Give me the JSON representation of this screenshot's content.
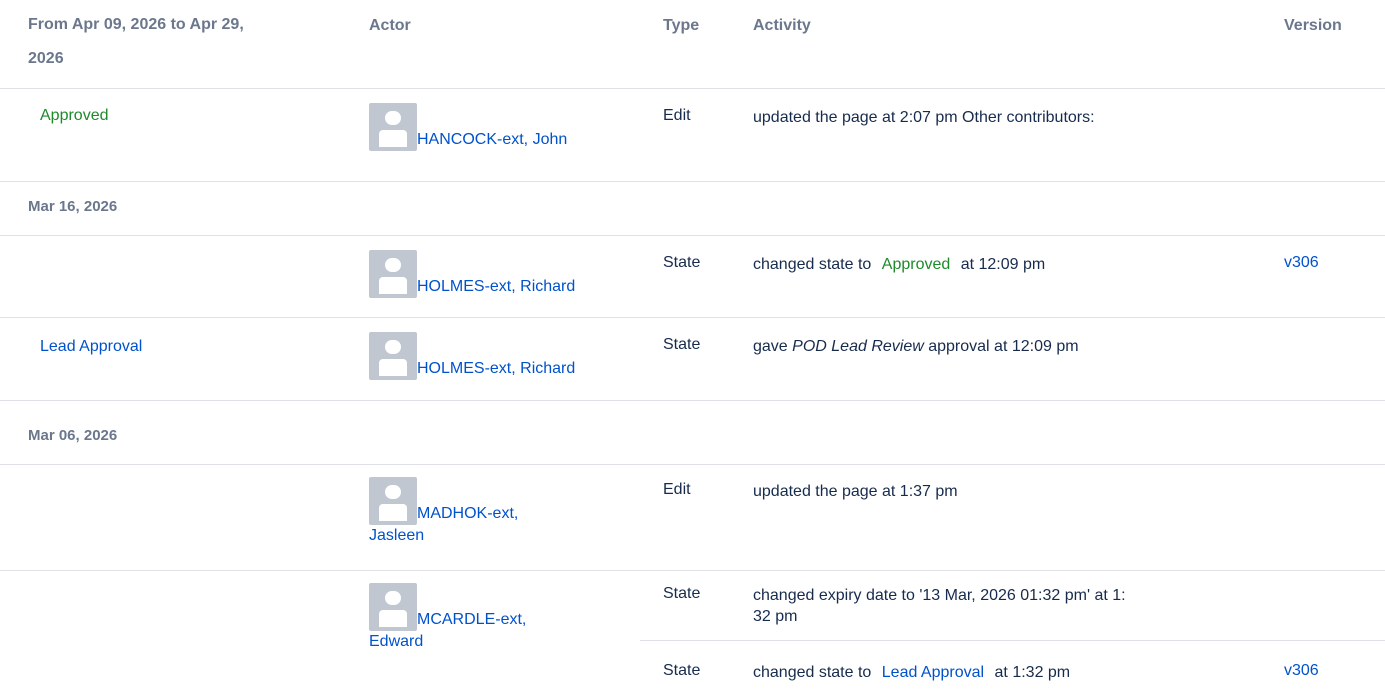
{
  "header": {
    "date_range": "From Apr 09, 2026 to Apr 29, 2026",
    "date_range_line1": "From Apr 09, 2026 to Apr 29,",
    "date_range_line2": "2026",
    "actor": "Actor",
    "type": "Type",
    "activity": "Activity",
    "version": "Version"
  },
  "groups": [
    {
      "rows": [
        {
          "state_badge": "Approved",
          "actor_name": "HANCOCK-ext, John",
          "type": "Edit",
          "activity": "updated the page at 2:07 pm Other contributors:",
          "version": ""
        }
      ]
    },
    {
      "date": "Mar 16, 2026",
      "rows": [
        {
          "actor_name": "HOLMES-ext, Richard",
          "type": "State",
          "activity_prefix": "changed state to",
          "activity_badge": "Approved",
          "activity_suffix": "at 12:09 pm",
          "version": "v306"
        },
        {
          "state_badge": "Lead Approval",
          "actor_name": "HOLMES-ext, Richard",
          "type": "State",
          "activity_prefix": "gave",
          "activity_italic": "POD Lead Review",
          "activity_suffix": "approval at 12:09 pm",
          "version": ""
        }
      ]
    },
    {
      "date": "Mar 06, 2026",
      "rows": [
        {
          "actor_name_line1": "MADHOK-ext,",
          "actor_name_line2": "Jasleen",
          "type": "Edit",
          "activity": "updated the page at 1:37 pm",
          "version": ""
        },
        {
          "actor_name_line1": "MCARDLE-ext,",
          "actor_name_line2": "Edward",
          "entries": [
            {
              "type": "State",
              "activity_line1": "changed expiry date to '13 Mar, 2026 01:32 pm' at 1:",
              "activity_line2": "32 pm",
              "version": ""
            },
            {
              "type": "State",
              "activity_prefix": "changed state to",
              "activity_badge": "Lead Approval",
              "activity_suffix": "at 1:32 pm",
              "version": "v306"
            }
          ]
        }
      ]
    }
  ],
  "colors": {
    "header_text": "#6b778c",
    "link": "#0052cc",
    "approved_green": "#1e8a2b",
    "avatar_gray": "#c1c7d0",
    "divider": "#dfe1e6"
  }
}
